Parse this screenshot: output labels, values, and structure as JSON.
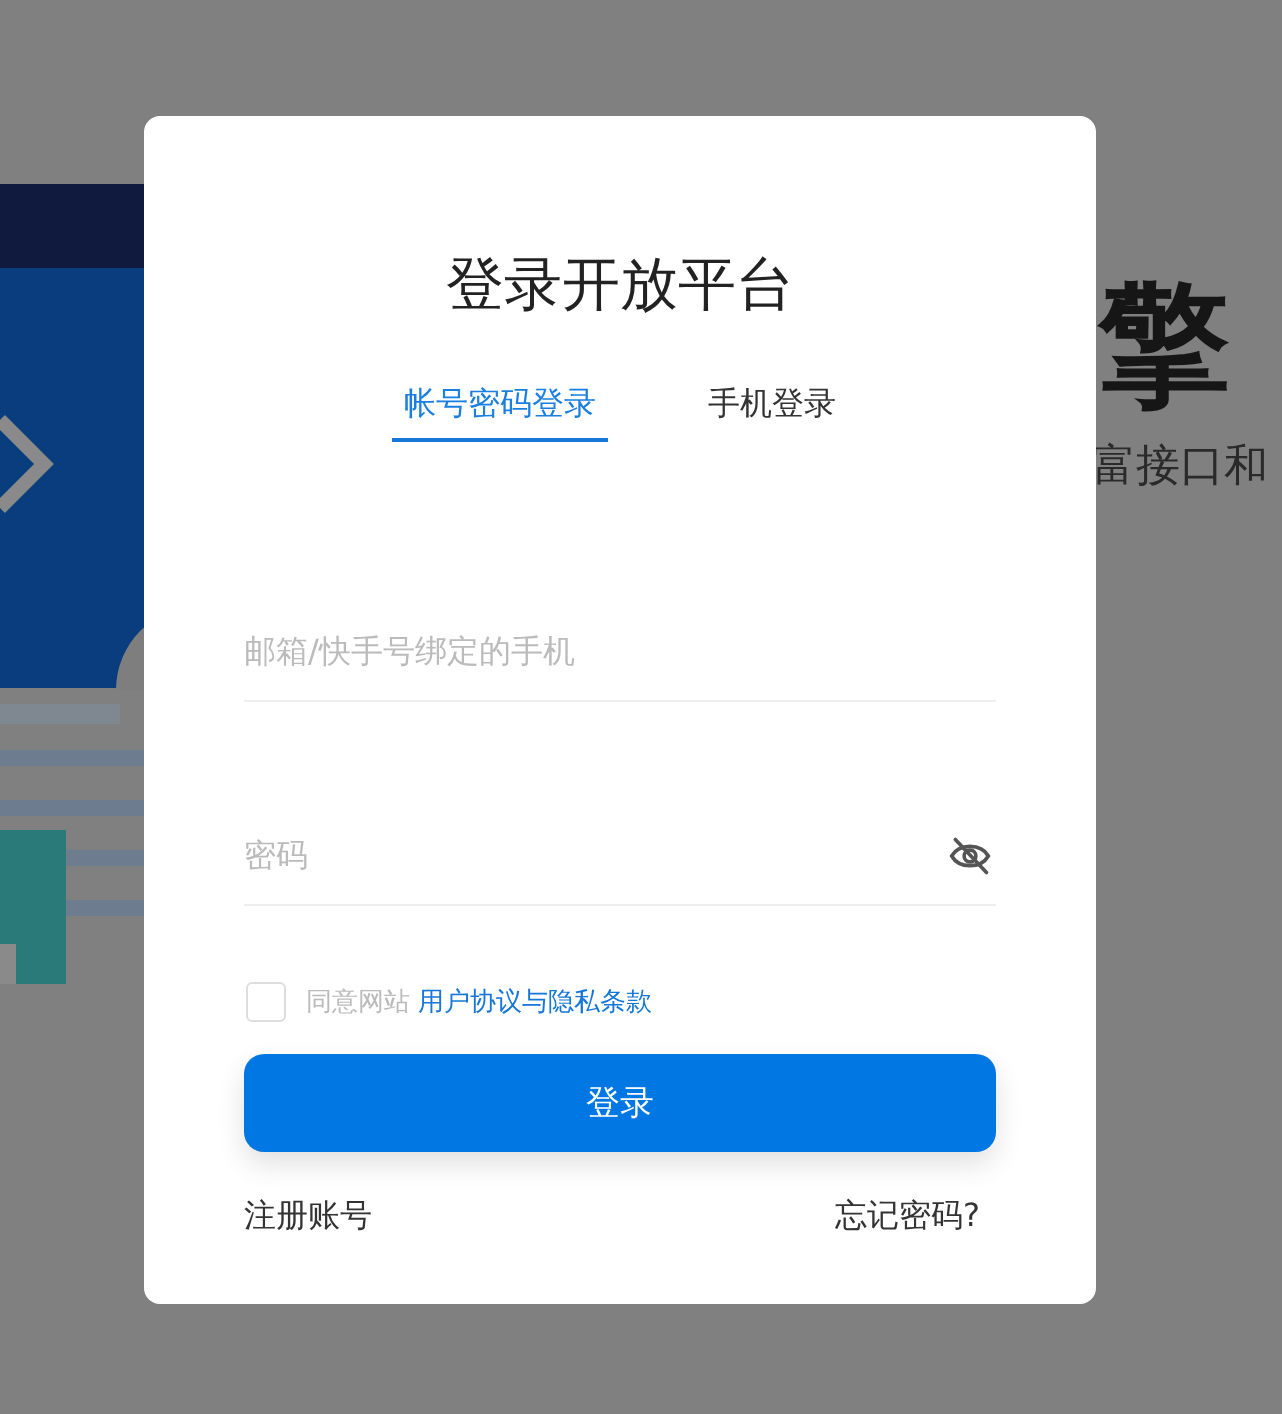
{
  "background": {
    "headline": "擎",
    "subtitle": "富接口和"
  },
  "modal": {
    "title": "登录开放平台",
    "tabs": [
      {
        "label": "帐号密码登录",
        "selected": true
      },
      {
        "label": "手机登录",
        "selected": false
      }
    ],
    "fields": [
      {
        "kind": "text",
        "placeholder": "邮箱/快手号绑定的手机"
      },
      {
        "kind": "password",
        "placeholder": "密码"
      }
    ],
    "agreement": {
      "checked": false,
      "text": "同意网站",
      "link": "用户协议与隐私条款"
    },
    "submit": "登录",
    "links": [
      "注册账号",
      "忘记密码?"
    ]
  }
}
